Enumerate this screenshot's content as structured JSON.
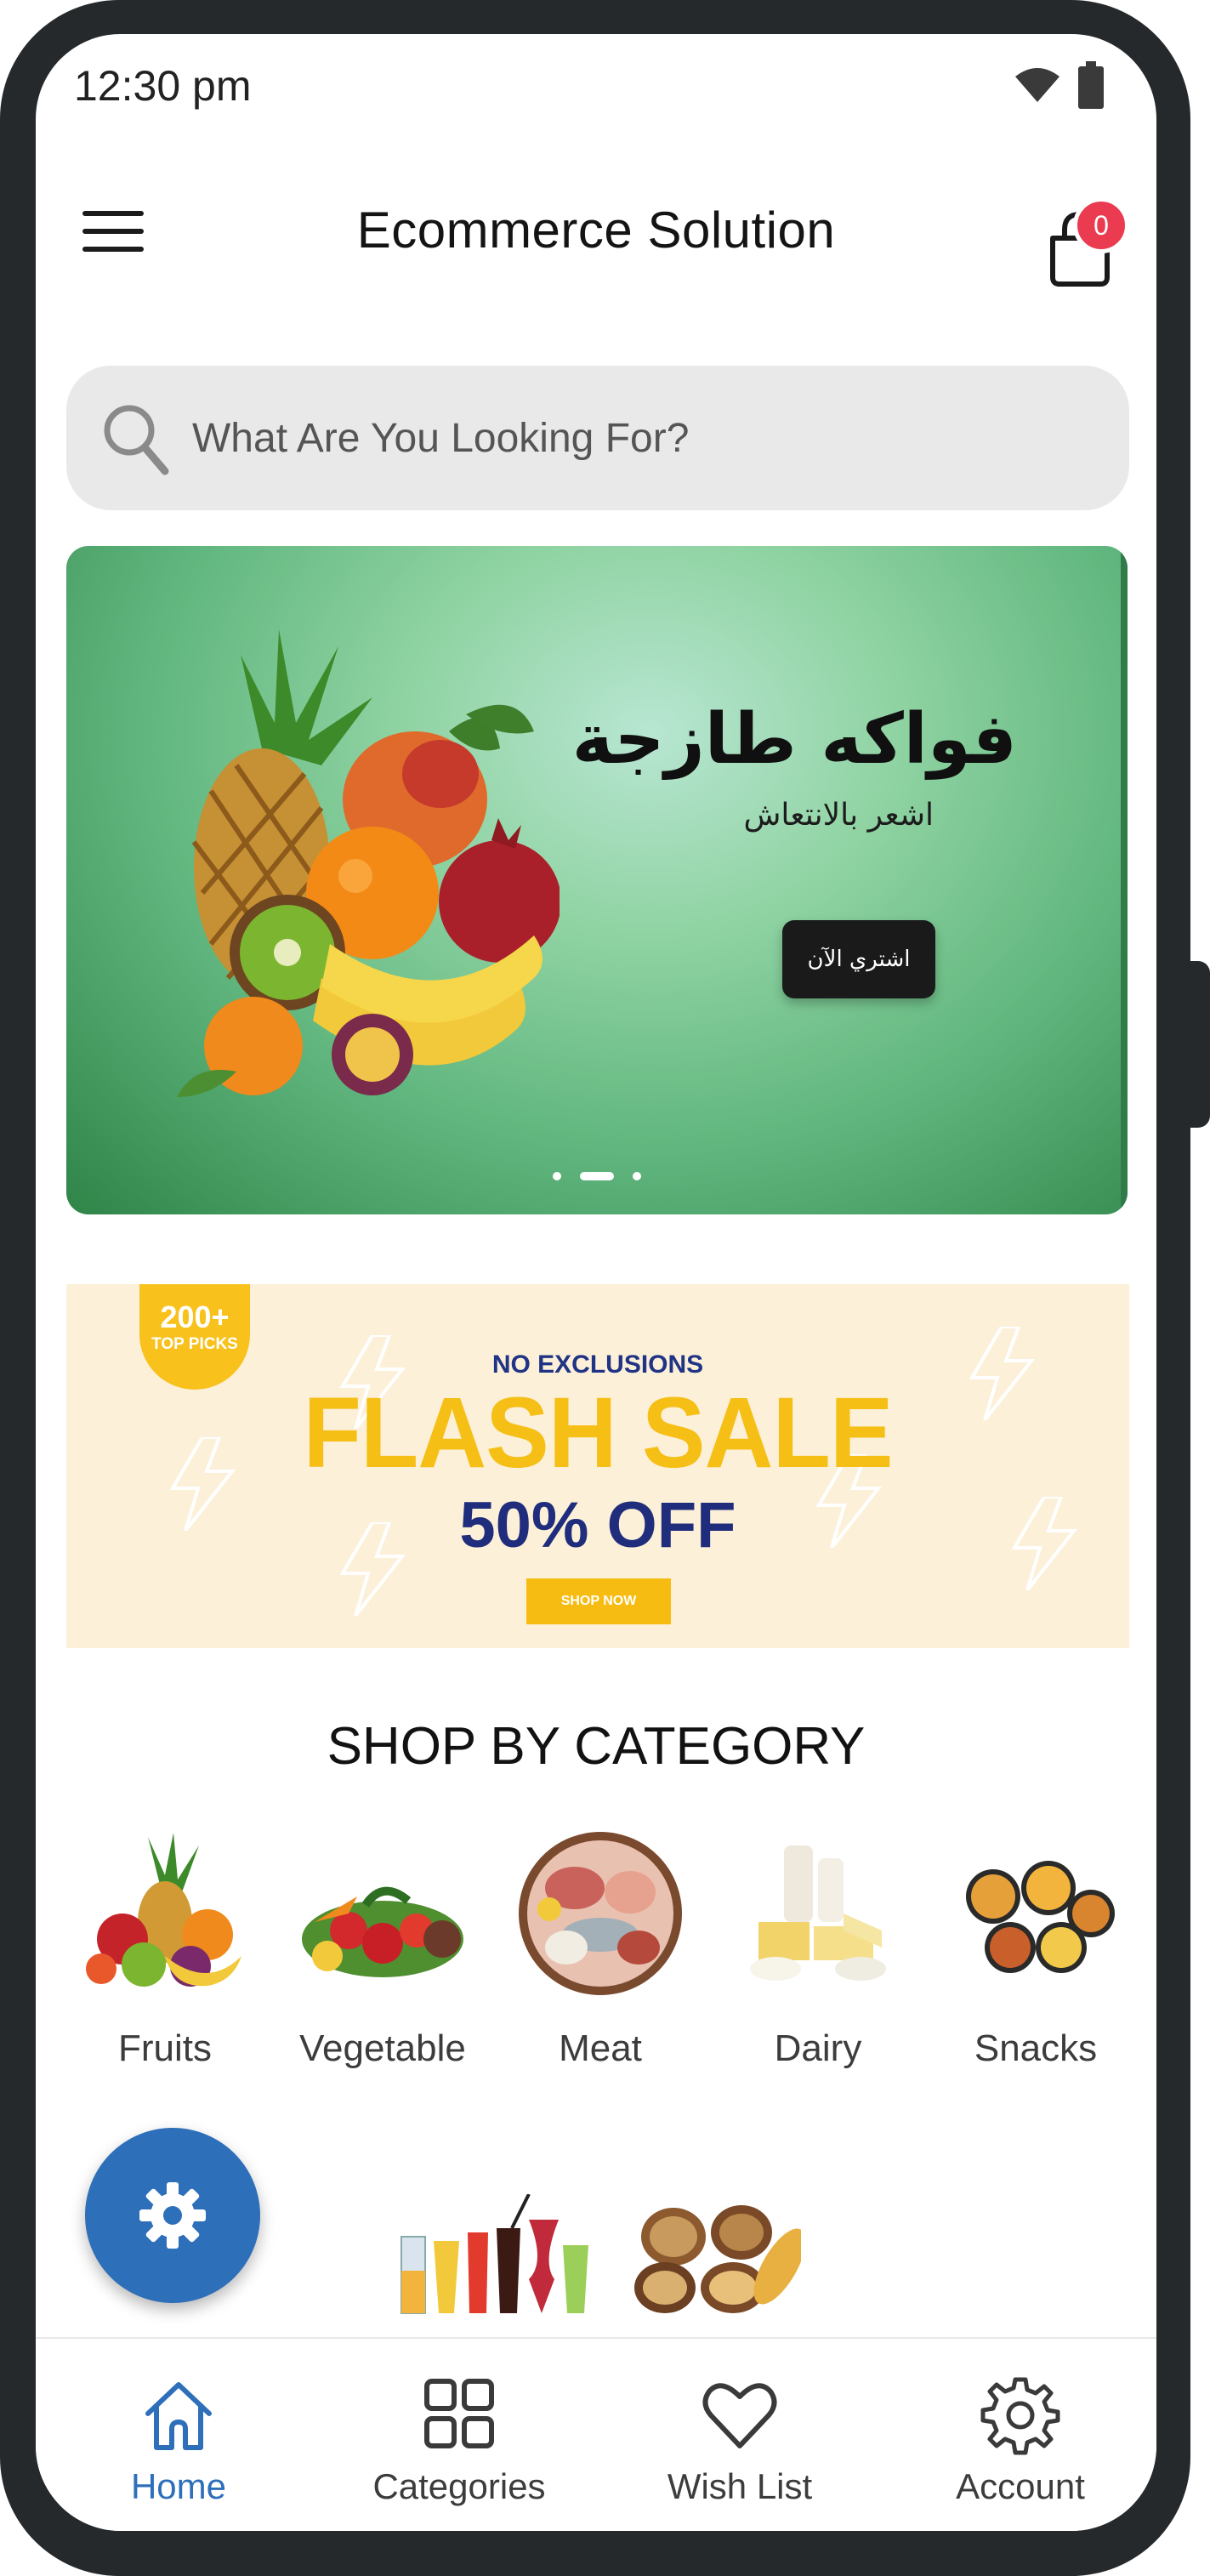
{
  "status_bar": {
    "time": "12:30 pm",
    "icons": [
      "wifi-icon",
      "battery-icon"
    ]
  },
  "header": {
    "title": "Ecommerce Solution",
    "menu_icon": "hamburger-menu-icon",
    "cart_icon": "shopping-bag-icon",
    "cart_count": "0"
  },
  "search": {
    "placeholder": "What Are You Looking For?",
    "value": ""
  },
  "hero_banner": {
    "title": "فواكه طازجة",
    "subtitle": "اشعر بالانتعاش",
    "button_label": "اشتري الآن",
    "slides_total": 3,
    "active_slide": 2
  },
  "flash_sale": {
    "badge_count": "200+",
    "badge_label": "TOP PICKS",
    "kicker": "NO EXCLUSIONS",
    "title": "FLASH SALE",
    "offer": "50% OFF",
    "button_label": "SHOP NOW"
  },
  "categories": {
    "title": "SHOP BY CATEGORY",
    "items": [
      {
        "label": "Fruits"
      },
      {
        "label": "Vegetable"
      },
      {
        "label": "Meat"
      },
      {
        "label": "Dairy"
      },
      {
        "label": "Snacks"
      }
    ]
  },
  "floating_action": {
    "icon": "settings-gear-icon"
  },
  "bottom_nav": {
    "items": [
      {
        "label": "Home",
        "icon": "home-icon",
        "active": true
      },
      {
        "label": "Categories",
        "icon": "grid-icon",
        "active": false
      },
      {
        "label": "Wish List",
        "icon": "heart-icon",
        "active": false
      },
      {
        "label": "Account",
        "icon": "gear-icon",
        "active": false
      }
    ]
  },
  "colors": {
    "accent": "#2e6fba",
    "badge": "#ea3b50",
    "flash_yellow": "#f5bf16",
    "flash_navy": "#1f2d7c"
  }
}
